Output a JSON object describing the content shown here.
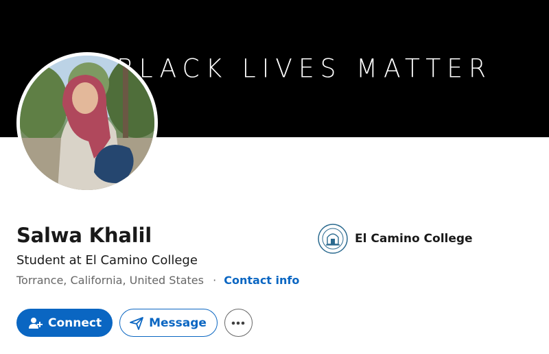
{
  "banner": {
    "text": "BLACK LIVES MATTER"
  },
  "profile": {
    "name": "Salwa Khalil",
    "headline": "Student at El Camino College",
    "location": "Torrance, California, United States",
    "separator": "·",
    "contact_info_label": "Contact info"
  },
  "education": {
    "school_name": "El Camino College",
    "logo_icon": "el-camino-college-seal"
  },
  "actions": {
    "connect_label": "Connect",
    "connect_icon": "add-person-icon",
    "message_label": "Message",
    "message_icon": "paper-plane-icon",
    "more_icon": "ellipsis-icon"
  },
  "colors": {
    "accent": "#0a66c2",
    "banner_bg": "#000000",
    "text_primary": "#191919",
    "text_secondary": "#666666"
  }
}
